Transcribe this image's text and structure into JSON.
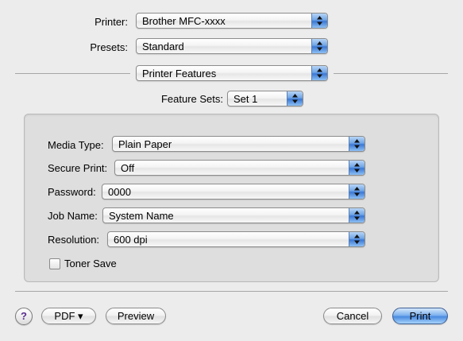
{
  "printer": {
    "label": "Printer:",
    "value": "Brother MFC-xxxx"
  },
  "presets": {
    "label": "Presets:",
    "value": "Standard"
  },
  "pane": {
    "value": "Printer Features"
  },
  "feature_sets": {
    "label": "Feature Sets:",
    "value": "Set 1"
  },
  "options": {
    "media_type": {
      "label": "Media Type:",
      "value": "Plain Paper"
    },
    "secure_print": {
      "label": "Secure Print:",
      "value": "Off"
    },
    "password": {
      "label": "Password:",
      "value": "0000"
    },
    "job_name": {
      "label": "Job Name:",
      "value": "System Name"
    },
    "resolution": {
      "label": "Resolution:",
      "value": "600 dpi"
    },
    "toner_save": {
      "label": "Toner Save",
      "checked": false
    }
  },
  "footer": {
    "help_label": "?",
    "pdf_label": "PDF ▾",
    "preview_label": "Preview",
    "cancel_label": "Cancel",
    "print_label": "Print"
  },
  "colors": {
    "accent": "#4a8ae0",
    "background": "#ececec"
  },
  "icons": {
    "popup": "up-down-arrows-icon",
    "help": "help-icon"
  }
}
